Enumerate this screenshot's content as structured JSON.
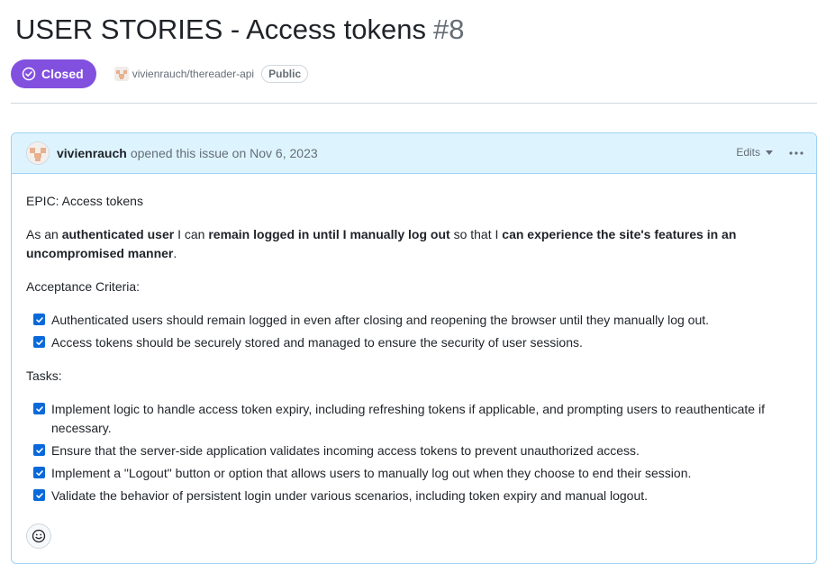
{
  "issue": {
    "title": "USER STORIES - Access tokens",
    "number": "#8",
    "state": "Closed",
    "repo": "vivienrauch/thereader-api",
    "visibility": "Public"
  },
  "comment": {
    "author": "vivienrauch",
    "opened_text": "opened this issue on Nov 6, 2023",
    "edits_label": "Edits",
    "epic": "EPIC: Access tokens",
    "story": {
      "p1": "As an ",
      "b1": "authenticated user",
      "p2": " I can ",
      "b2": "remain logged in until I manually log out",
      "p3": " so that I ",
      "b3": "can experience the site's features in an uncompromised manner",
      "p4": "."
    },
    "acceptance_heading": "Acceptance Criteria:",
    "acceptance_items": [
      {
        "text": "Authenticated users should remain logged in even after closing and reopening the browser until they manually log out.",
        "checked": true
      },
      {
        "text": "Access tokens should be securely stored and managed to ensure the security of user sessions.",
        "checked": true
      }
    ],
    "tasks_heading": "Tasks:",
    "task_items": [
      {
        "text": "Implement logic to handle access token expiry, including refreshing tokens if applicable, and prompting users to reauthenticate if necessary.",
        "checked": true
      },
      {
        "text": "Ensure that the server-side application validates incoming access tokens to prevent unauthorized access.",
        "checked": true
      },
      {
        "text": "Implement a \"Logout\" button or option that allows users to manually log out when they choose to end their session.",
        "checked": true
      },
      {
        "text": "Validate the behavior of persistent login under various scenarios, including token expiry and manual logout.",
        "checked": true
      }
    ]
  },
  "icons": {
    "state": "circle-check-icon",
    "more": "kebab-icon",
    "reaction": "smiley-icon"
  },
  "colors": {
    "closed_badge": "#8250df",
    "header_bg": "#ddf4ff",
    "header_border": "#9ed2f5",
    "checkbox": "#0969da"
  }
}
